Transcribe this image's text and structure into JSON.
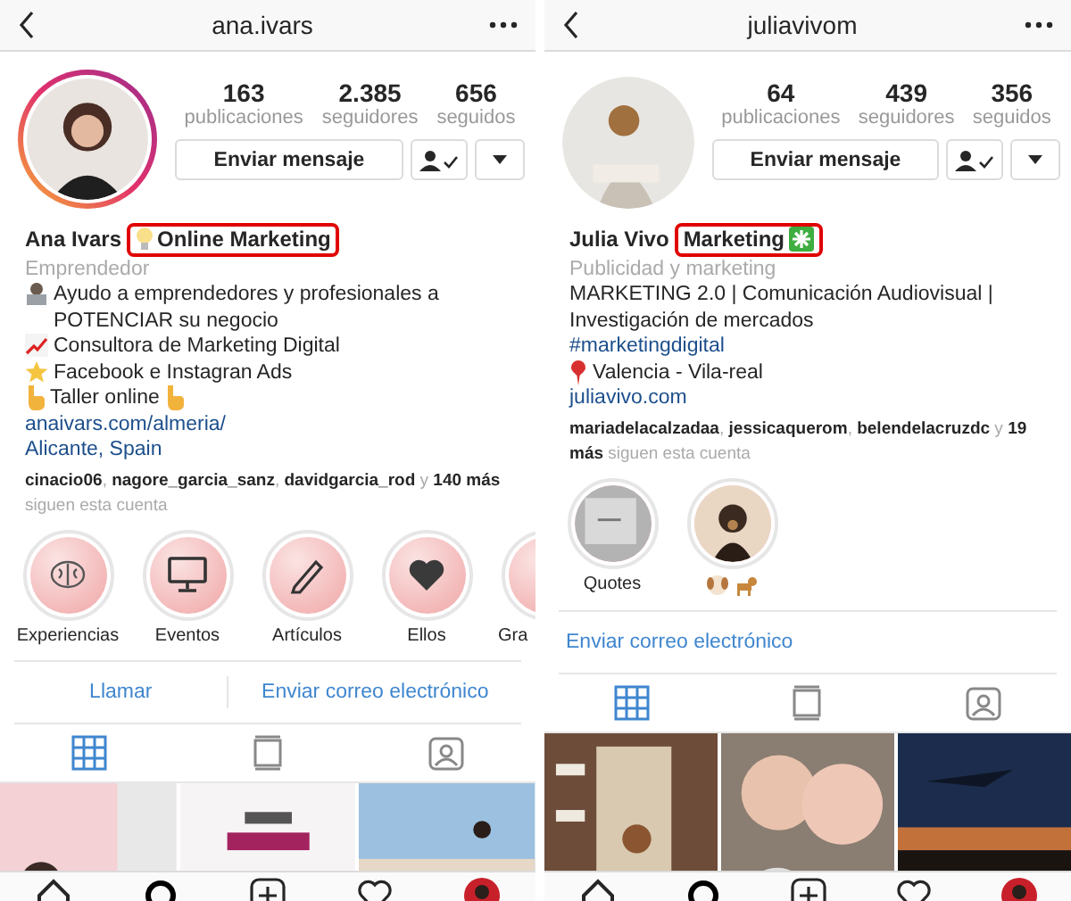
{
  "profiles": [
    {
      "header": {
        "title": "ana.ivars"
      },
      "avatar": {
        "kind": "picture",
        "story_ring": true
      },
      "stats": [
        {
          "value": "163",
          "label": "publicaciones"
        },
        {
          "value": "2.385",
          "label": "seguidores"
        },
        {
          "value": "656",
          "label": "seguidos"
        }
      ],
      "message_button": "Enviar mensaje",
      "name": "Ana Ivars",
      "headline": "Online Marketing",
      "headline_highlighted": true,
      "category": "Emprendedor",
      "bio": [
        {
          "kind": "text",
          "text": "Ayudo a emprendedores y profesionales a POTENCIAR su negocio"
        },
        {
          "kind": "text",
          "text": "Consultora de Marketing Digital"
        },
        {
          "kind": "text",
          "text": "Facebook e Instagran Ads"
        },
        {
          "kind": "text",
          "text": "Taller online"
        },
        {
          "kind": "link",
          "text": "anaivars.com/almeria/"
        },
        {
          "kind": "link",
          "text": "Alicante, Spain"
        }
      ],
      "followers": "**cinacio06**, **nagore_garcia_sanz**, **davidgarcia_rod** y **140 más** siguen esta cuenta",
      "highlights": [
        {
          "kind": "icon",
          "label": "Experiencias"
        },
        {
          "kind": "icon",
          "label": "Eventos"
        },
        {
          "kind": "icon",
          "label": "Artículos"
        },
        {
          "kind": "icon",
          "label": "Ellos"
        },
        {
          "kind": "icon",
          "label": "Gra"
        }
      ],
      "actions": [
        "Llamar",
        "Enviar correo electrónico"
      ],
      "tabs": [
        {
          "selected": true
        },
        {
          "selected": false
        },
        {
          "selected": false
        }
      ],
      "posts": [
        {
          "kind": "picture"
        },
        {
          "kind": "picture"
        },
        {
          "kind": "picture"
        }
      ]
    },
    {
      "header": {
        "title": "juliavivom"
      },
      "avatar": {
        "kind": "picture",
        "story_ring": false
      },
      "stats": [
        {
          "value": "64",
          "label": "publicaciones"
        },
        {
          "value": "439",
          "label": "seguidores"
        },
        {
          "value": "356",
          "label": "seguidos"
        }
      ],
      "message_button": "Enviar mensaje",
      "name": "Julia Vivo",
      "headline": "Marketing",
      "headline_highlighted": true,
      "category": "Publicidad y marketing",
      "bio": [
        {
          "kind": "text",
          "text": "MARKETING 2.0 | Comunicación Audiovisual | Investigación de mercados"
        },
        {
          "kind": "link",
          "text": "#marketingdigital"
        },
        {
          "kind": "text",
          "text": "Valencia - Vila-real"
        },
        {
          "kind": "link",
          "text": "juliavivo.com"
        }
      ],
      "followers": "**mariadelacalzadaa**, **jessicaquerom**, **belendelacruzdc** y **19 más** siguen esta cuenta",
      "highlights": [
        {
          "kind": "picture",
          "label": "Quotes"
        },
        {
          "kind": "picture"
        }
      ],
      "actions": [
        "Enviar correo electrónico"
      ],
      "tabs": [
        {
          "selected": true
        },
        {
          "selected": false
        },
        {
          "selected": false
        }
      ],
      "posts": [
        {
          "kind": "picture"
        },
        {
          "kind": "picture"
        },
        {
          "kind": "picture"
        }
      ]
    }
  ]
}
